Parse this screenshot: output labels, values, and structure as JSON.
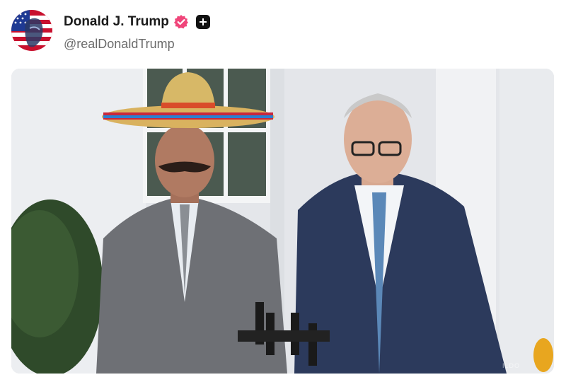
{
  "post": {
    "author": {
      "display_name": "Donald J. Trump",
      "handle": "@realDonaldTrump",
      "verified_icon": "verified-badge-icon",
      "follow_icon": "plus-icon",
      "verified_color": "#f0457a"
    },
    "media": {
      "watermark": "ILDO"
    }
  }
}
